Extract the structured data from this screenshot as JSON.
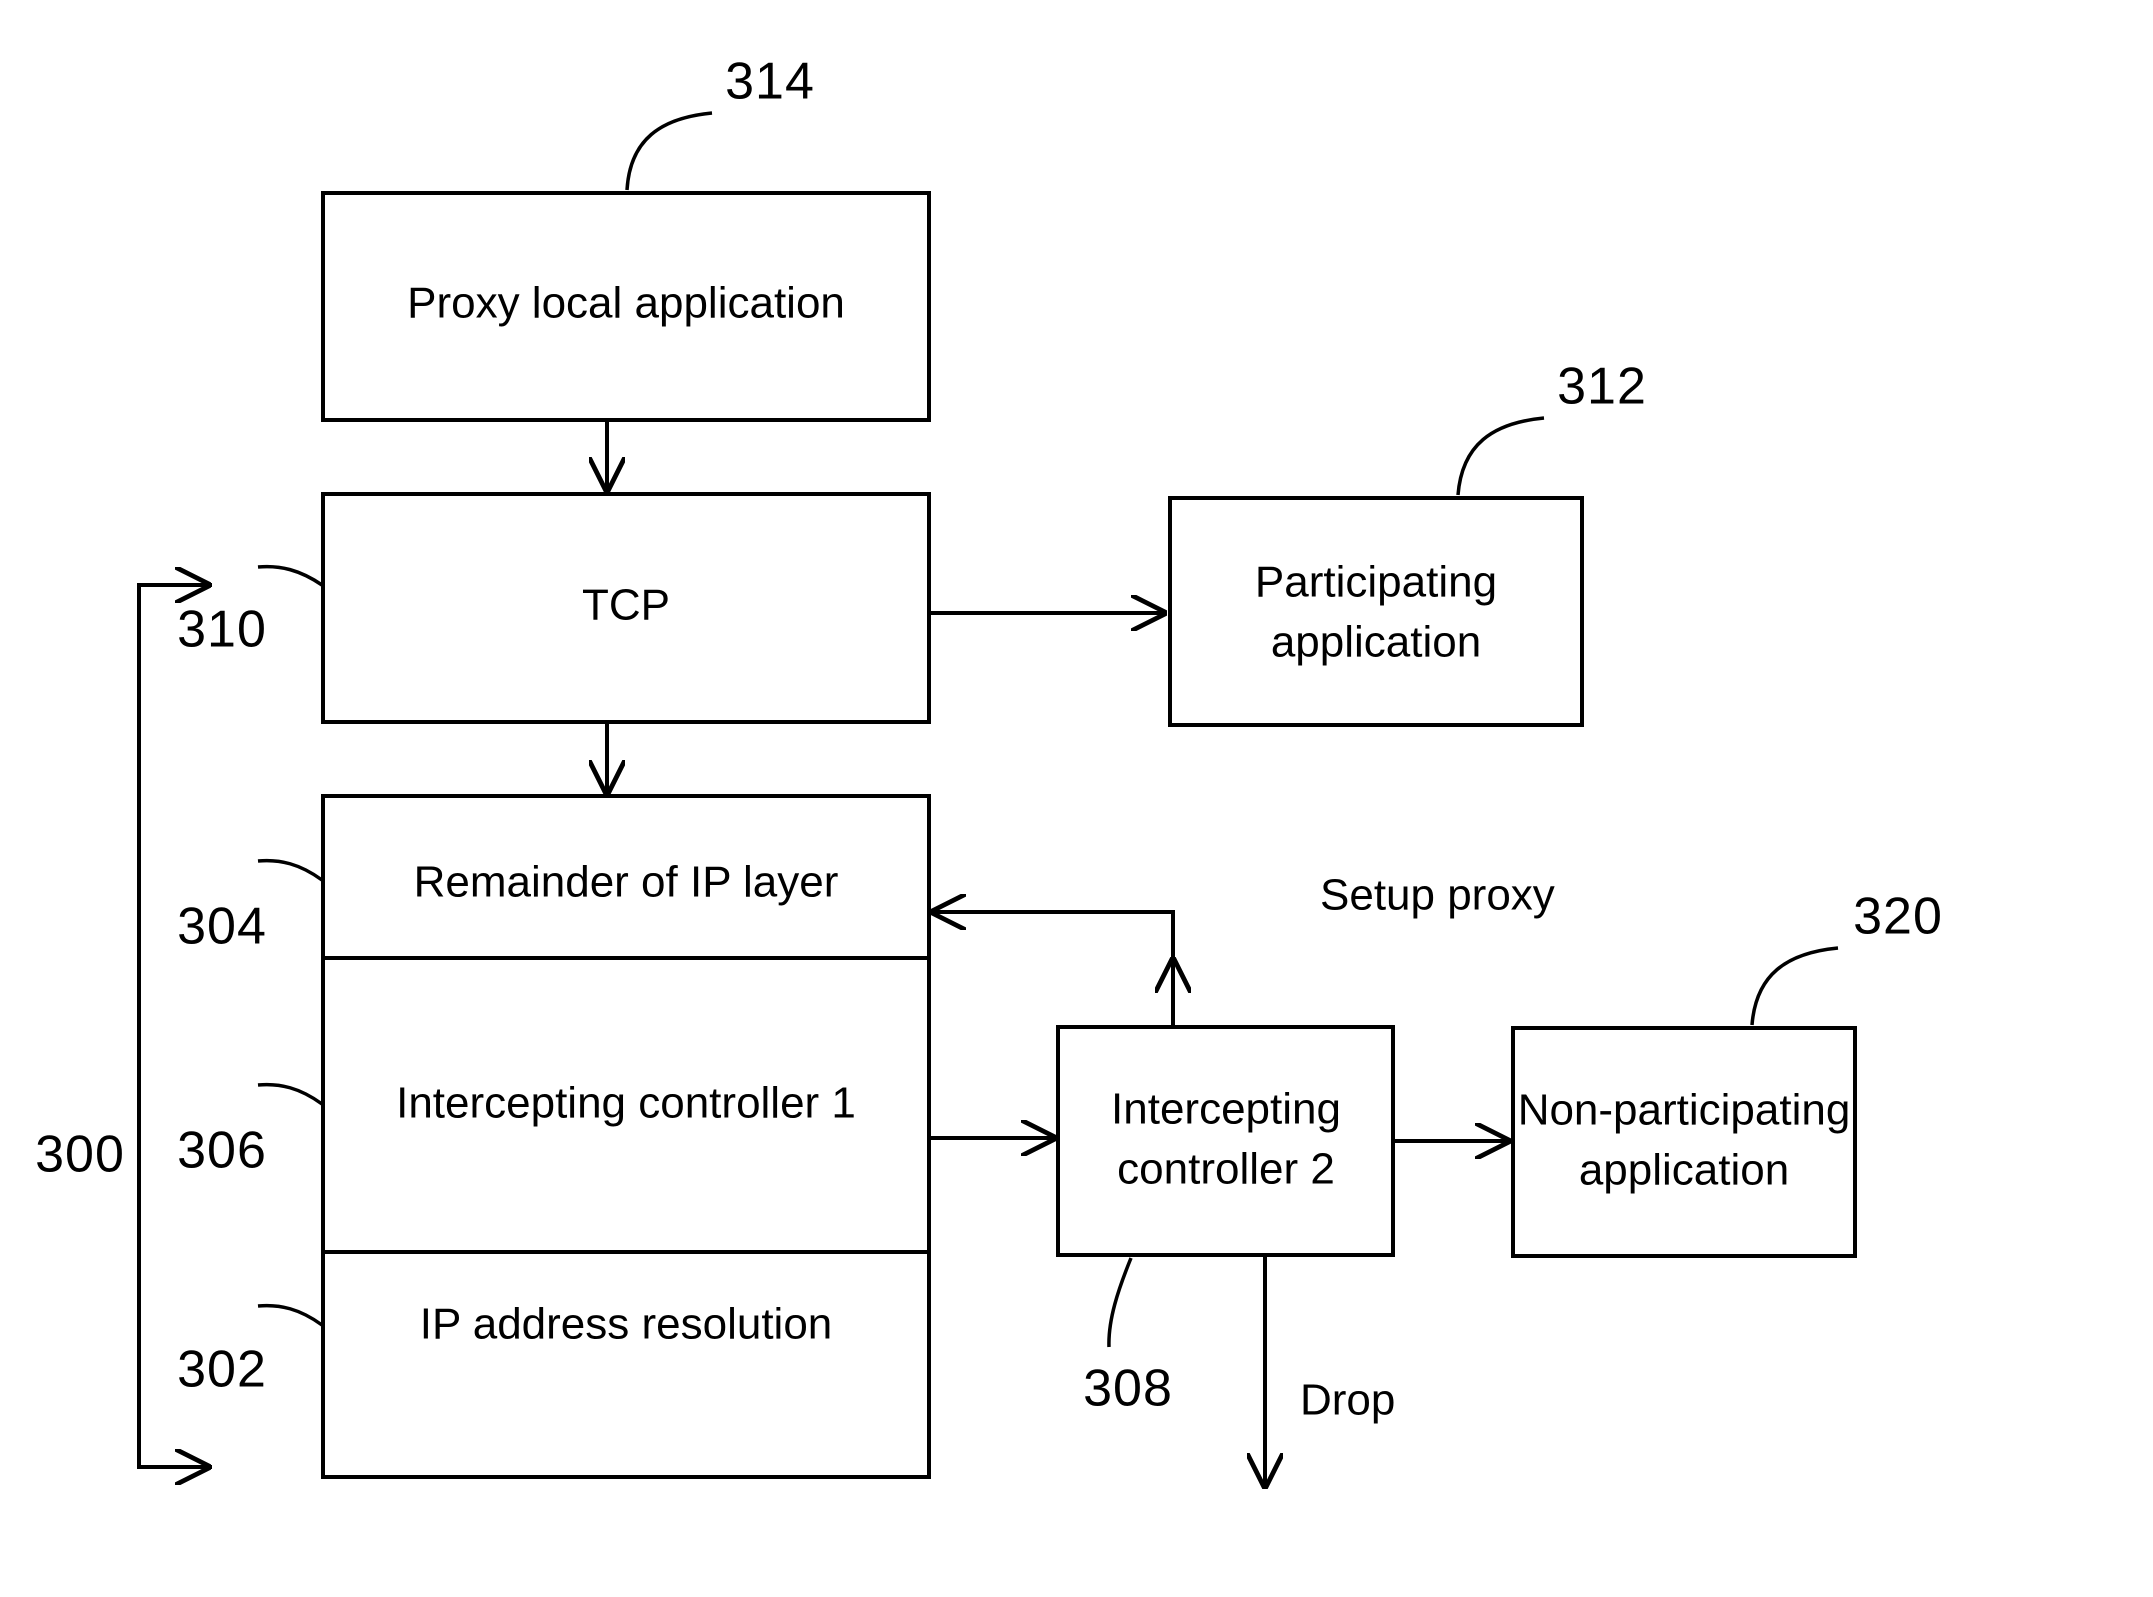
{
  "figure": {
    "type": "patent-block-diagram",
    "boxes": [
      {
        "id": "proxy_local_application",
        "label": "Proxy local application",
        "ref": "314"
      },
      {
        "id": "tcp",
        "label": "TCP",
        "ref": "310"
      },
      {
        "id": "participating_application",
        "label_line1": "Participating",
        "label_line2": "application",
        "ref": "312"
      },
      {
        "id": "remainder_of_ip_layer",
        "label": "Remainder of IP layer",
        "ref": "304"
      },
      {
        "id": "intercepting_controller_1",
        "label": "Intercepting controller 1",
        "ref": "306"
      },
      {
        "id": "ip_address_resolution",
        "label": "IP address resolution",
        "ref": "302"
      },
      {
        "id": "intercepting_controller_2",
        "label_line1": "Intercepting",
        "label_line2": "controller 2",
        "ref": "308"
      },
      {
        "id": "non_participating_application",
        "label_line1": "Non-participating",
        "label_line2": "application",
        "ref": "320"
      }
    ],
    "stack_ref": "300",
    "edge_labels": {
      "setup_proxy": "Setup proxy",
      "drop": "Drop"
    },
    "colors": {
      "stroke": "#000000",
      "background": "#ffffff"
    }
  }
}
